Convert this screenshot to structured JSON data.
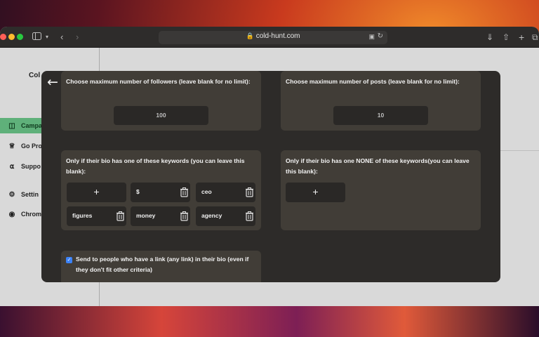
{
  "browser": {
    "url": "cold-hunt.com"
  },
  "sidebar": {
    "brand": "Col",
    "items": [
      {
        "label": "Campa",
        "icon": "chat-icon",
        "active": true
      },
      {
        "label": "Go Pro",
        "icon": "crown-icon",
        "active": false
      },
      {
        "label": "Suppo",
        "icon": "headset-icon",
        "active": false
      },
      {
        "label": "Settin",
        "icon": "gear-icon",
        "active": false
      },
      {
        "label": "Chrom",
        "icon": "chrome-icon",
        "active": false
      }
    ]
  },
  "modal": {
    "followers": {
      "title": "Choose maximum number of followers (leave blank for no limit):",
      "value": "100"
    },
    "posts": {
      "title": "Choose maximum number of posts (leave blank for no limit):",
      "value": "10"
    },
    "include_keywords": {
      "title": "Only if their bio has one of these keywords (you can leave this blank):",
      "add_label": "+",
      "keywords": [
        "$",
        "ceo",
        "figures",
        "money",
        "agency"
      ]
    },
    "exclude_keywords": {
      "title": "Only if their bio has one NONE of these keywords(you can leave this blank):",
      "add_label": "+"
    },
    "link_option": {
      "label": "Send to people who have a link (any link) in their bio (even if they don't fit other criteria)",
      "checked": true
    }
  },
  "colors": {
    "accent_green": "#5fb07a",
    "modal_bg": "#2d2b29",
    "card_bg": "#413d37",
    "checkbox_blue": "#3b82f6"
  }
}
